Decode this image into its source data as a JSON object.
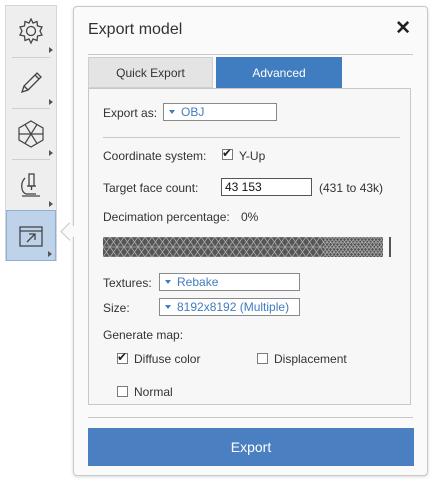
{
  "toolbar": {
    "tools": [
      {
        "icon": "gear-icon"
      },
      {
        "icon": "pencil-icon"
      },
      {
        "icon": "mesh-icon"
      },
      {
        "icon": "microscope-icon"
      },
      {
        "icon": "export-icon",
        "active": true
      }
    ]
  },
  "panel": {
    "title": "Export model",
    "close_label": "✕"
  },
  "tabs": {
    "quick_export": "Quick Export",
    "advanced": "Advanced",
    "active": "Advanced"
  },
  "form": {
    "export_as_label": "Export as:",
    "export_as_value": "OBJ",
    "coordinate_system_label": "Coordinate system:",
    "y_up_label": "Y-Up",
    "y_up_checked": true,
    "target_face_count_label": "Target face count:",
    "target_face_count_value": "43 153",
    "target_face_count_range": "(431 to 43k)",
    "decimation_label": "Decimation percentage:",
    "decimation_value": "0%",
    "textures_label": "Textures:",
    "textures_value": "Rebake",
    "size_label": "Size:",
    "size_value": "8192x8192 (Multiple)",
    "generate_map_label": "Generate map:",
    "maps": {
      "diffuse_label": "Diffuse color",
      "diffuse_checked": true,
      "displacement_label": "Displacement",
      "displacement_checked": false,
      "normal_label": "Normal",
      "normal_checked": false
    }
  },
  "export_button": "Export",
  "colors": {
    "accent": "#3f7cc0",
    "export_button": "#4a80c2",
    "active_tool": "#bed2ea"
  }
}
